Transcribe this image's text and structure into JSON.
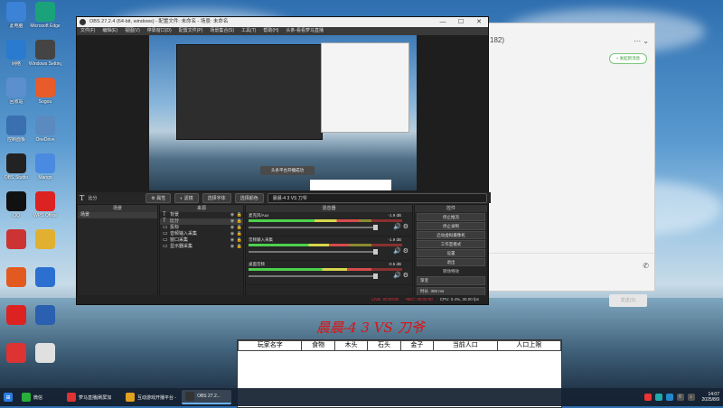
{
  "desktop": {
    "icons": [
      {
        "label": "此电脑",
        "icon": "computer-icon",
        "color": "#3c82d6"
      },
      {
        "label": "Microsoft Edge",
        "icon": "edge-icon",
        "color": "#1aa37a"
      },
      {
        "label": "网络",
        "icon": "network-icon",
        "color": "#2a7bd0"
      },
      {
        "label": "Windows Settings",
        "icon": "settings-icon",
        "color": "#444"
      },
      {
        "label": "回收站",
        "icon": "recycle-bin-icon",
        "color": "#5b8fd0"
      },
      {
        "label": "Sogou",
        "icon": "sogou-icon",
        "color": "#e85b2a"
      },
      {
        "label": "控制面板",
        "icon": "control-panel-icon",
        "color": "#3a6fb0"
      },
      {
        "label": "OneDrive",
        "icon": "onedrive-icon",
        "color": "#5a8ac0"
      },
      {
        "label": "OBS Studio",
        "icon": "obs-icon",
        "color": "#222"
      },
      {
        "label": "Mango",
        "icon": "mango-icon",
        "color": "#4a8ae0"
      },
      {
        "label": "QQ",
        "icon": "qq-icon",
        "color": "#111"
      },
      {
        "label": "WPS Office",
        "icon": "wps-icon",
        "color": "#d22"
      },
      {
        "label": "",
        "icon": "game-icon",
        "color": "#c33"
      },
      {
        "label": "",
        "icon": "character-icon",
        "color": "#e2b030"
      },
      {
        "label": "",
        "icon": "cast-icon",
        "color": "#e25a20"
      },
      {
        "label": "",
        "icon": "k-app-icon",
        "color": "#2b6fd1"
      },
      {
        "label": "",
        "icon": "red-app-icon",
        "color": "#d22"
      },
      {
        "label": "",
        "icon": "doc-icon",
        "color": "#2b5fb0"
      },
      {
        "label": "",
        "icon": "box-icon",
        "color": "#d33"
      },
      {
        "label": "",
        "icon": "file-icon",
        "color": "#e0e0e0"
      }
    ]
  },
  "chat": {
    "count": "182)",
    "new_button": "+ 发起新消息",
    "send_button": "发送(S)"
  },
  "obs": {
    "title": "OBS 27.2.4 (64-bit, windows) - 配置文件: 未命名 - 场景: 未命名",
    "menu": [
      "文件(F)",
      "编辑(E)",
      "视图(V)",
      "停靠窗口(D)",
      "配置文件(P)",
      "场景集合(S)",
      "工具(T)",
      "帮助(H)",
      "头条-看看萝马直播"
    ],
    "toast": "头条平台开播成功",
    "source_bar": {
      "current_source": "比分",
      "properties": "属性",
      "filters": "滤镜",
      "select_font": "选择字体",
      "select_color": "选择颜色",
      "text_value": "晨晨-4 3 VS 刀爷"
    },
    "scenes": {
      "header": "场景",
      "items": [
        "场景"
      ]
    },
    "sources": {
      "header": "来源",
      "items": [
        {
          "icon": "T",
          "label": "背景"
        },
        {
          "icon": "T",
          "label": "比分"
        },
        {
          "icon": "▭",
          "label": "投标"
        },
        {
          "icon": "▭",
          "label": "音频输入采集"
        },
        {
          "icon": "▭",
          "label": "窗口采集"
        },
        {
          "icon": "▭",
          "label": "显示器采集"
        }
      ]
    },
    "mixer": {
      "header": "混音器",
      "channels": [
        {
          "name": "麦克风/Aux",
          "db": "-1.9 dB",
          "level": 0.72
        },
        {
          "name": "音频输入采集",
          "db": "-1.9 dB",
          "level": 0.65
        },
        {
          "name": "桌面音频",
          "db": "-0.5 dB",
          "level": 0.8
        }
      ]
    },
    "controls": {
      "header": "控件",
      "buttons": [
        "停止推流",
        "停止录制",
        "启动虚拟摄像机",
        "工作室模式",
        "设置",
        "退出"
      ],
      "transitions_label": "转场特效",
      "transition": "渐变",
      "duration_label": "时长",
      "duration": "300 ms"
    },
    "status": {
      "live": "LIVE: 00:00:00",
      "rec": "REC: 00:00:00",
      "cpu": "CPU: 0.4%, 30.00 fps"
    }
  },
  "game": {
    "title": "晨晨-4 3 VS 刀爷",
    "columns": [
      "玩家名字",
      "食物",
      "木头",
      "石头",
      "金子",
      "当前人口",
      "人口上限"
    ]
  },
  "taskbar": {
    "items": [
      {
        "label": "微信",
        "icon": "wechat-icon",
        "color": "#2aae3a"
      },
      {
        "label": "萝马直播|刷屏加",
        "icon": "live-icon",
        "color": "#d33"
      },
      {
        "label": "互动游戏开播平台 - ",
        "icon": "chrome-icon",
        "color": "#e0a020"
      },
      {
        "label": "OBS 27.2...",
        "icon": "obs-icon",
        "color": "#333"
      }
    ],
    "time": "14:07",
    "date": "2025/8/9"
  }
}
